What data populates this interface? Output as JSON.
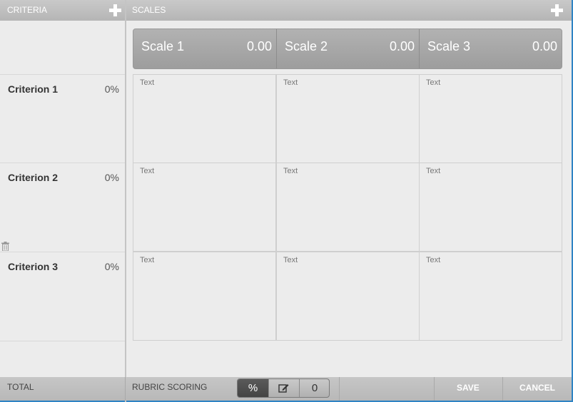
{
  "criteria_header": {
    "title": "CRITERIA"
  },
  "scales_header": {
    "title": "SCALES"
  },
  "criteria": [
    {
      "name": "Criterion 1",
      "percent": "0%"
    },
    {
      "name": "Criterion 2",
      "percent": "0%"
    },
    {
      "name": "Criterion 3",
      "percent": "0%"
    }
  ],
  "scales": [
    {
      "name": "Scale 1",
      "value": "0.00"
    },
    {
      "name": "Scale 2",
      "value": "0.00"
    },
    {
      "name": "Scale 3",
      "value": "0.00"
    }
  ],
  "cells": [
    [
      "Text",
      "Text",
      "Text"
    ],
    [
      "Text",
      "Text",
      "Text"
    ],
    [
      "Text",
      "Text",
      "Text"
    ]
  ],
  "footer": {
    "total_label": "TOTAL",
    "rubric_label": "RUBRIC SCORING",
    "scoring_options": [
      "%",
      "edit-icon",
      "0"
    ],
    "save_label": "SAVE",
    "cancel_label": "CANCEL"
  },
  "colors": {
    "accent_border": "#2f84c4",
    "header_bg": "#b5b5b5",
    "active_toggle": "#444444"
  }
}
